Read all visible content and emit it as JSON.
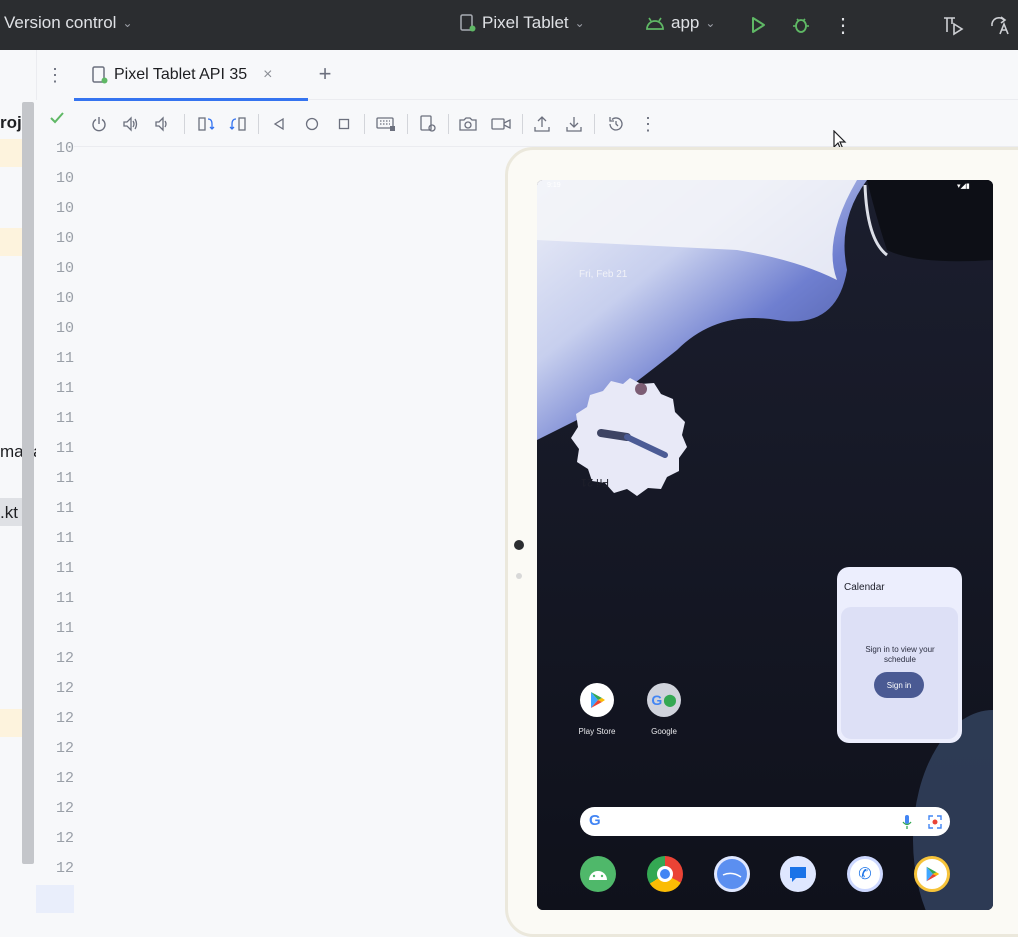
{
  "topbar": {
    "vcs_label": "Version control",
    "device_label": "Pixel Tablet",
    "run_config_label": "app",
    "colors": {
      "run": "#5fb865",
      "debug": "#5fb865",
      "bg": "#2b2d30",
      "text": "#dfe1e5"
    }
  },
  "left_panel": {
    "project_label": "roje",
    "manager_label": "mana",
    "file_label": ".kt"
  },
  "gutter": {
    "line_numbers": [
      "10",
      "10",
      "10",
      "10",
      "10",
      "10",
      "10",
      "11",
      "11",
      "11",
      "11",
      "11",
      "11",
      "11",
      "11",
      "11",
      "11",
      "12",
      "12",
      "12",
      "12",
      "12",
      "12",
      "12",
      "12",
      "12"
    ]
  },
  "tabbar": {
    "tab_label": "Pixel Tablet API 35",
    "close_symbol": "×",
    "add_symbol": "+"
  },
  "emulator": {
    "status_time": "9:19",
    "date_text": "Fri, Feb 21",
    "clock_date": "Fri 21",
    "calendar_widget": {
      "title": "Calendar",
      "message": "Sign in to view your schedule",
      "button_label": "Sign in"
    },
    "apps": [
      {
        "label": "Play Store",
        "icon": "play-store-icon"
      },
      {
        "label": "Google",
        "icon": "google-icon"
      }
    ],
    "dock": [
      "android-icon",
      "chrome-icon",
      "browser-icon",
      "messages-icon",
      "phone-icon",
      "play-icon"
    ]
  }
}
